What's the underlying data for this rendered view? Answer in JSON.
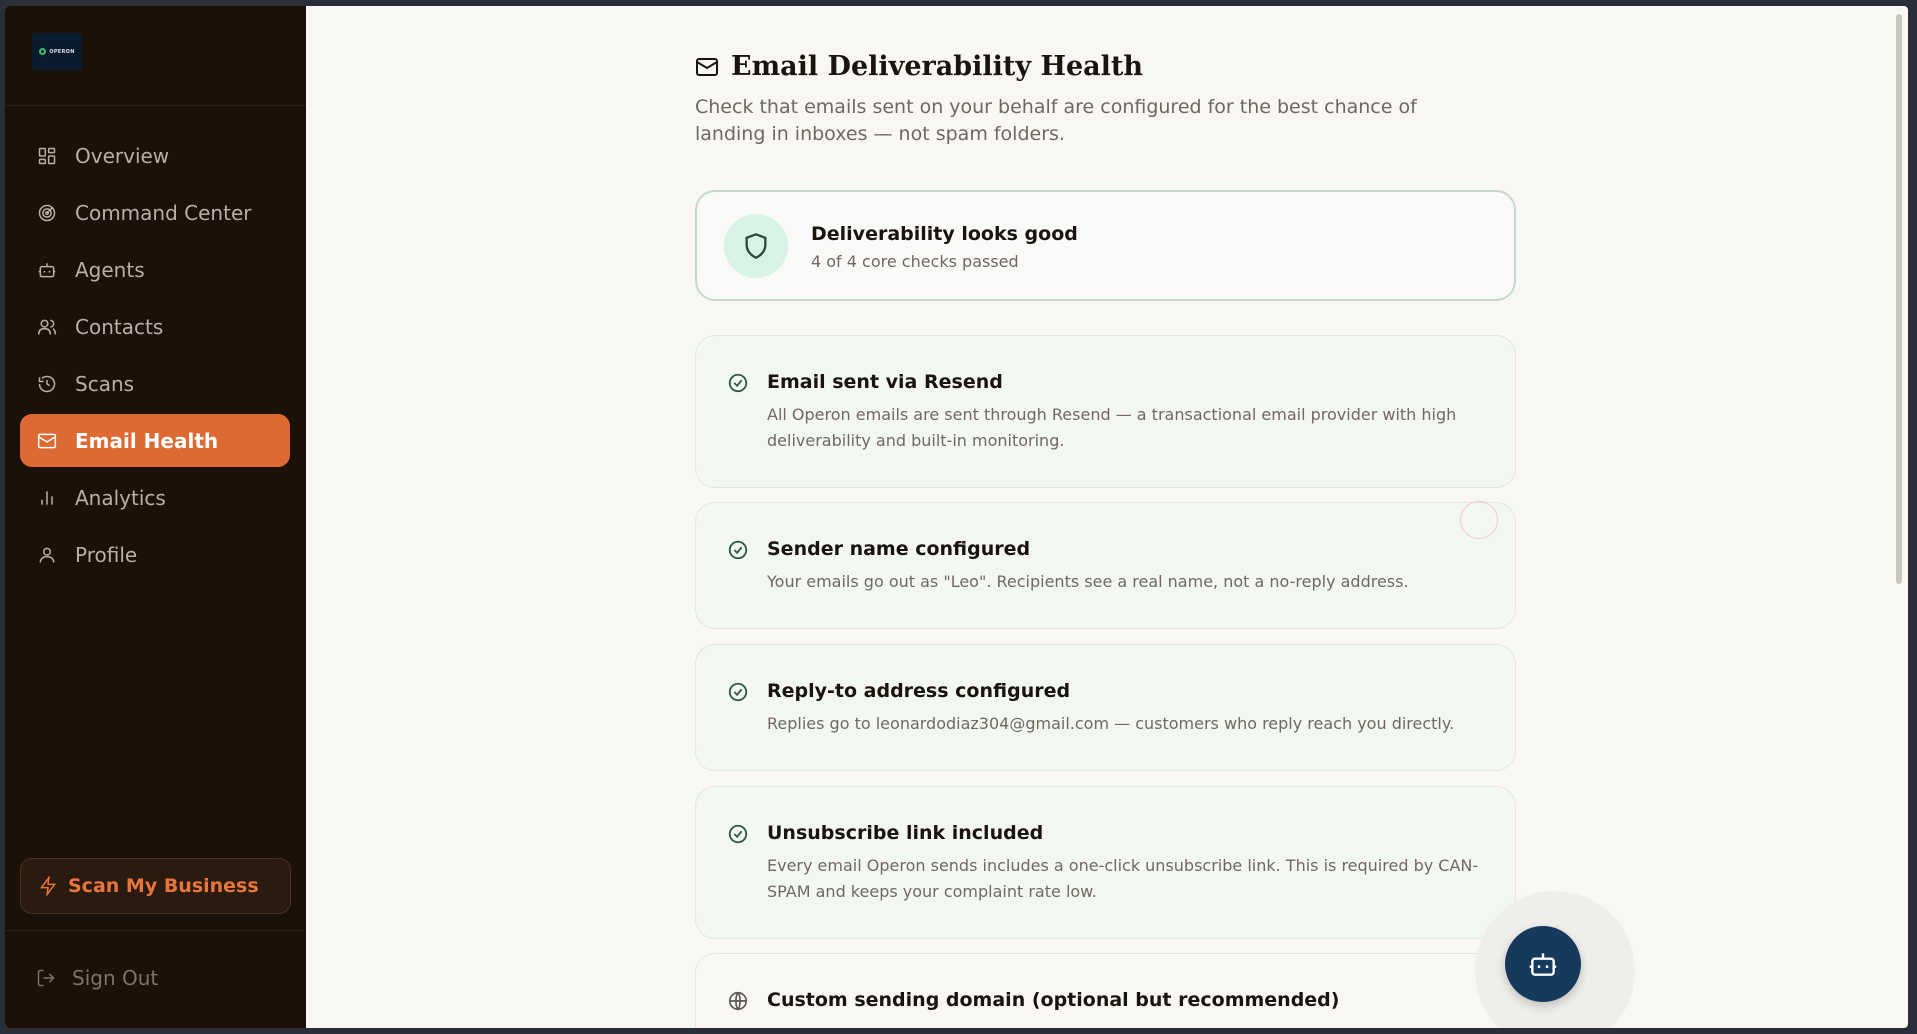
{
  "brand": {
    "logo_text": "OPERON"
  },
  "sidebar": {
    "items": [
      {
        "label": "Overview",
        "icon": "grid-icon"
      },
      {
        "label": "Command Center",
        "icon": "radar-icon"
      },
      {
        "label": "Agents",
        "icon": "bot-icon"
      },
      {
        "label": "Contacts",
        "icon": "users-icon"
      },
      {
        "label": "Scans",
        "icon": "history-icon"
      },
      {
        "label": "Email Health",
        "icon": "mail-icon",
        "active": true
      },
      {
        "label": "Analytics",
        "icon": "bar-chart-icon"
      },
      {
        "label": "Profile",
        "icon": "user-icon"
      }
    ],
    "scan_button": "Scan My Business",
    "sign_out": "Sign Out"
  },
  "page": {
    "title": "Email Deliverability Health",
    "subtitle": "Check that emails sent on your behalf are configured for the best chance of landing in inboxes — not spam folders."
  },
  "summary": {
    "title": "Deliverability looks good",
    "subtitle": "4 of 4 core checks passed"
  },
  "checks": [
    {
      "title": "Email sent via Resend",
      "description": "All Operon emails are sent through Resend — a transactional email provider with high deliverability and built-in monitoring.",
      "status": "passed"
    },
    {
      "title": "Sender name configured",
      "description": "Your emails go out as \"Leo\". Recipients see a real name, not a no-reply address.",
      "status": "passed"
    },
    {
      "title": "Reply-to address configured",
      "description": "Replies go to leonardodiaz304@gmail.com — customers who reply reach you directly.",
      "status": "passed"
    },
    {
      "title": "Unsubscribe link included",
      "description": "Every email Operon sends includes a one-click unsubscribe link. This is required by CAN-SPAM and keeps your complaint rate low.",
      "status": "passed"
    },
    {
      "title": "Custom sending domain (optional but recommended)",
      "description": "",
      "status": "optional"
    }
  ],
  "colors": {
    "sidebar_bg": "#1c1109",
    "accent": "#dc6a32",
    "success": "#2f7a55",
    "fab_bg": "#153a5c"
  }
}
